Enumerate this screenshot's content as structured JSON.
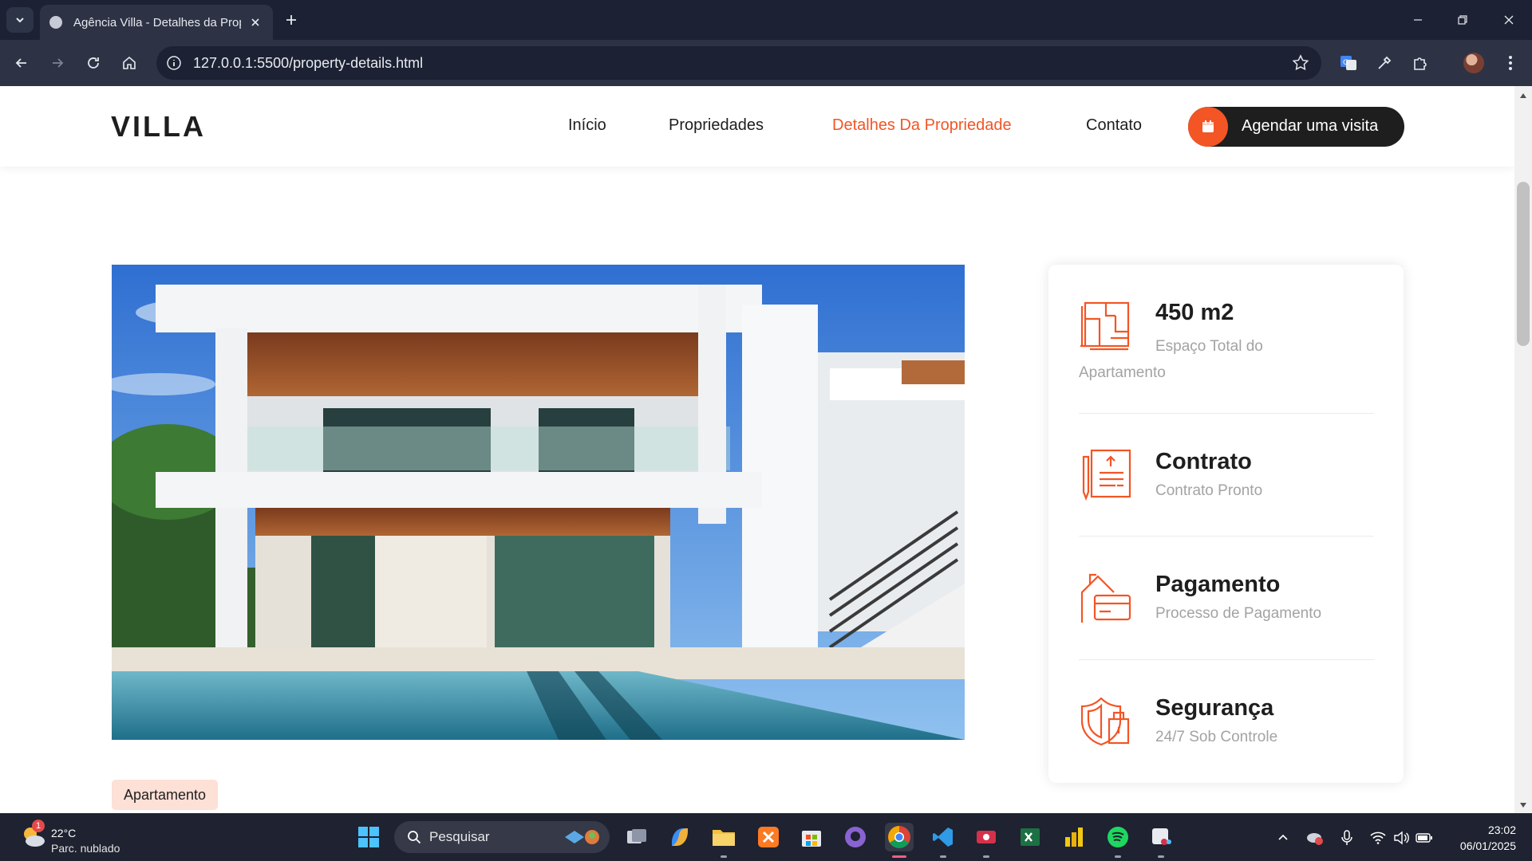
{
  "browser": {
    "tab_title": "Agência Villa - Detalhes da Propriedade",
    "url": "127.0.0.1:5500/property-details.html"
  },
  "header": {
    "logo": "VILLA",
    "nav": [
      {
        "label": "Início"
      },
      {
        "label": "Propriedades"
      },
      {
        "label": "Detalhes Da Propriedade",
        "active": true
      },
      {
        "label": "Contato"
      }
    ],
    "cta_label": "Agendar uma visita"
  },
  "property": {
    "category_badge": "Apartamento"
  },
  "info": [
    {
      "title": "450 m2",
      "subtitle": "Espaço Total do Apartamento",
      "icon": "floor-plan-icon"
    },
    {
      "title": "Contrato",
      "subtitle": "Contrato Pronto",
      "icon": "contract-icon"
    },
    {
      "title": "Pagamento",
      "subtitle": "Processo de Pagamento",
      "icon": "payment-icon"
    },
    {
      "title": "Segurança",
      "subtitle": "24/7 Sob Controle",
      "icon": "security-icon"
    }
  ],
  "taskbar": {
    "weather_temp": "22°C",
    "weather_desc": "Parc. nublado",
    "weather_badge": "1",
    "search_placeholder": "Pesquisar",
    "time": "23:02",
    "date": "06/01/2025"
  },
  "colors": {
    "accent": "#f35525",
    "dark": "#1e1e1e",
    "muted": "#a3a3a3",
    "badge_bg": "#fde0d6"
  }
}
